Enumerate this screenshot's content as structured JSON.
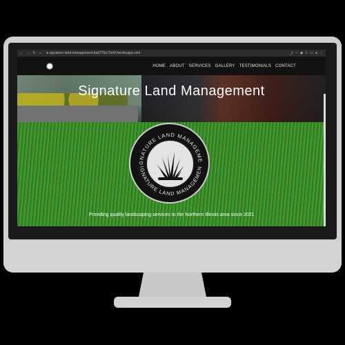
{
  "browser": {
    "url": "signature-land-management-bad775a72ef0.herokuapp.com",
    "left_icons": [
      "back-icon",
      "forward-icon",
      "reload-icon",
      "home-icon"
    ]
  },
  "nav": {
    "items": [
      {
        "label": "HOME"
      },
      {
        "label": "ABOUT"
      },
      {
        "label": "SERVICES"
      },
      {
        "label": "GALLERY"
      },
      {
        "label": "TESTIMONIALS"
      },
      {
        "label": "CONTACT"
      }
    ]
  },
  "hero": {
    "title": "Signature Land Management",
    "tagline": "Providing quality landscaping services to the Northern Illinois area since 2021"
  },
  "logo": {
    "ring_text": "SIGNATURE LAND MANAGEMENT"
  }
}
